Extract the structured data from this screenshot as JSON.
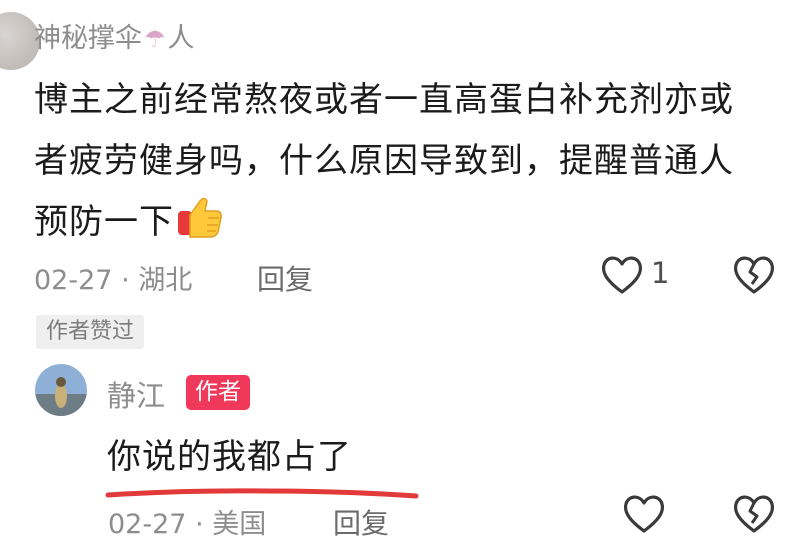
{
  "comment": {
    "username": "神秘撑伞",
    "username_suffix": "人",
    "username_emoji": "umbrella-emoji",
    "text": "博主之前经常熬夜或者一直高蛋白补充剂亦或者疲劳健身吗，什么原因导致到，提醒普通人 预防一下",
    "text_emoji": "thumbs-up-emoji",
    "date": "02-27",
    "separator": "·",
    "location": "湖北",
    "reply_label": "回复",
    "like_count": "1",
    "author_liked_tag": "作者赞过"
  },
  "reply": {
    "username": "静江",
    "badge": "作者",
    "text": "你说的我都占了",
    "date": "02-27",
    "separator": "·",
    "location": "美国",
    "reply_label": "回复"
  },
  "colors": {
    "badge": "#f0385a",
    "underline": "#e23a3a",
    "meta_text": "#8d8d8d"
  }
}
